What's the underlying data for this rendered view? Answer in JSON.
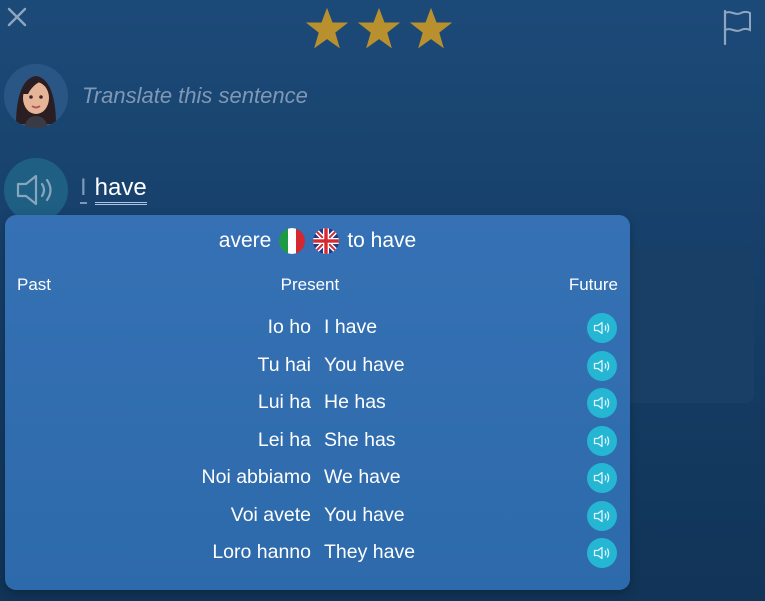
{
  "header": {
    "stars": 3,
    "close_icon": "close-icon",
    "flag_icon": "flag-icon"
  },
  "prompt": {
    "text": "Translate this sentence"
  },
  "sentence": {
    "words": [
      "I",
      "have"
    ]
  },
  "popup": {
    "verb_it": "avere",
    "verb_en": "to have",
    "tabs": {
      "past": "Past",
      "present": "Present",
      "future": "Future"
    },
    "rows": [
      {
        "it": "Io ho",
        "en": "I have"
      },
      {
        "it": "Tu hai",
        "en": "You have"
      },
      {
        "it": "Lui ha",
        "en": "He has"
      },
      {
        "it": "Lei ha",
        "en": "She has"
      },
      {
        "it": "Noi abbiamo",
        "en": "We have"
      },
      {
        "it": "Voi avete",
        "en": "You have"
      },
      {
        "it": "Loro hanno",
        "en": "They have"
      }
    ]
  },
  "colors": {
    "star": "#b8902e",
    "play_button": "#25b6d3",
    "popup_bg": "#3370b2"
  }
}
